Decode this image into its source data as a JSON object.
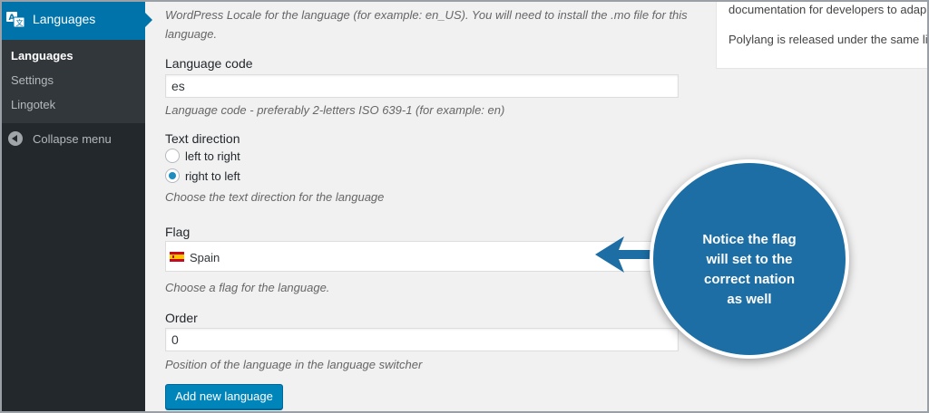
{
  "sidebar": {
    "menu_title": "Languages",
    "items": [
      {
        "label": "Languages"
      },
      {
        "label": "Settings"
      },
      {
        "label": "Lingotek"
      }
    ],
    "collapse_label": "Collapse menu"
  },
  "form": {
    "locale_description_line1": "WordPress Locale for the language (for example: en_US). You will need to install the .mo file for this",
    "locale_description_line2": "language.",
    "language_code": {
      "label": "Language code",
      "value": "es",
      "description": "Language code - preferably 2-letters ISO 639-1 (for example: en)"
    },
    "text_direction": {
      "label": "Text direction",
      "options": [
        "left to right",
        "right to left"
      ],
      "selected": "right to left",
      "description": "Choose the text direction for the language"
    },
    "flag": {
      "label": "Flag",
      "value": "Spain",
      "description": "Choose a flag for the language."
    },
    "order": {
      "label": "Order",
      "value": "0",
      "description": "Position of the language in the language switcher"
    },
    "submit_label": "Add new language"
  },
  "info_box": {
    "line1": "documentation for developers to adap",
    "line2": "Polylang is released under the same lic"
  },
  "callout": {
    "lines": [
      "Notice the flag",
      "will set to the",
      "correct nation",
      "as well"
    ]
  },
  "colors": {
    "sidebar_bg": "#23282d",
    "accent": "#0073aa",
    "button": "#0085ba",
    "callout_bg": "#1c6ea4"
  }
}
